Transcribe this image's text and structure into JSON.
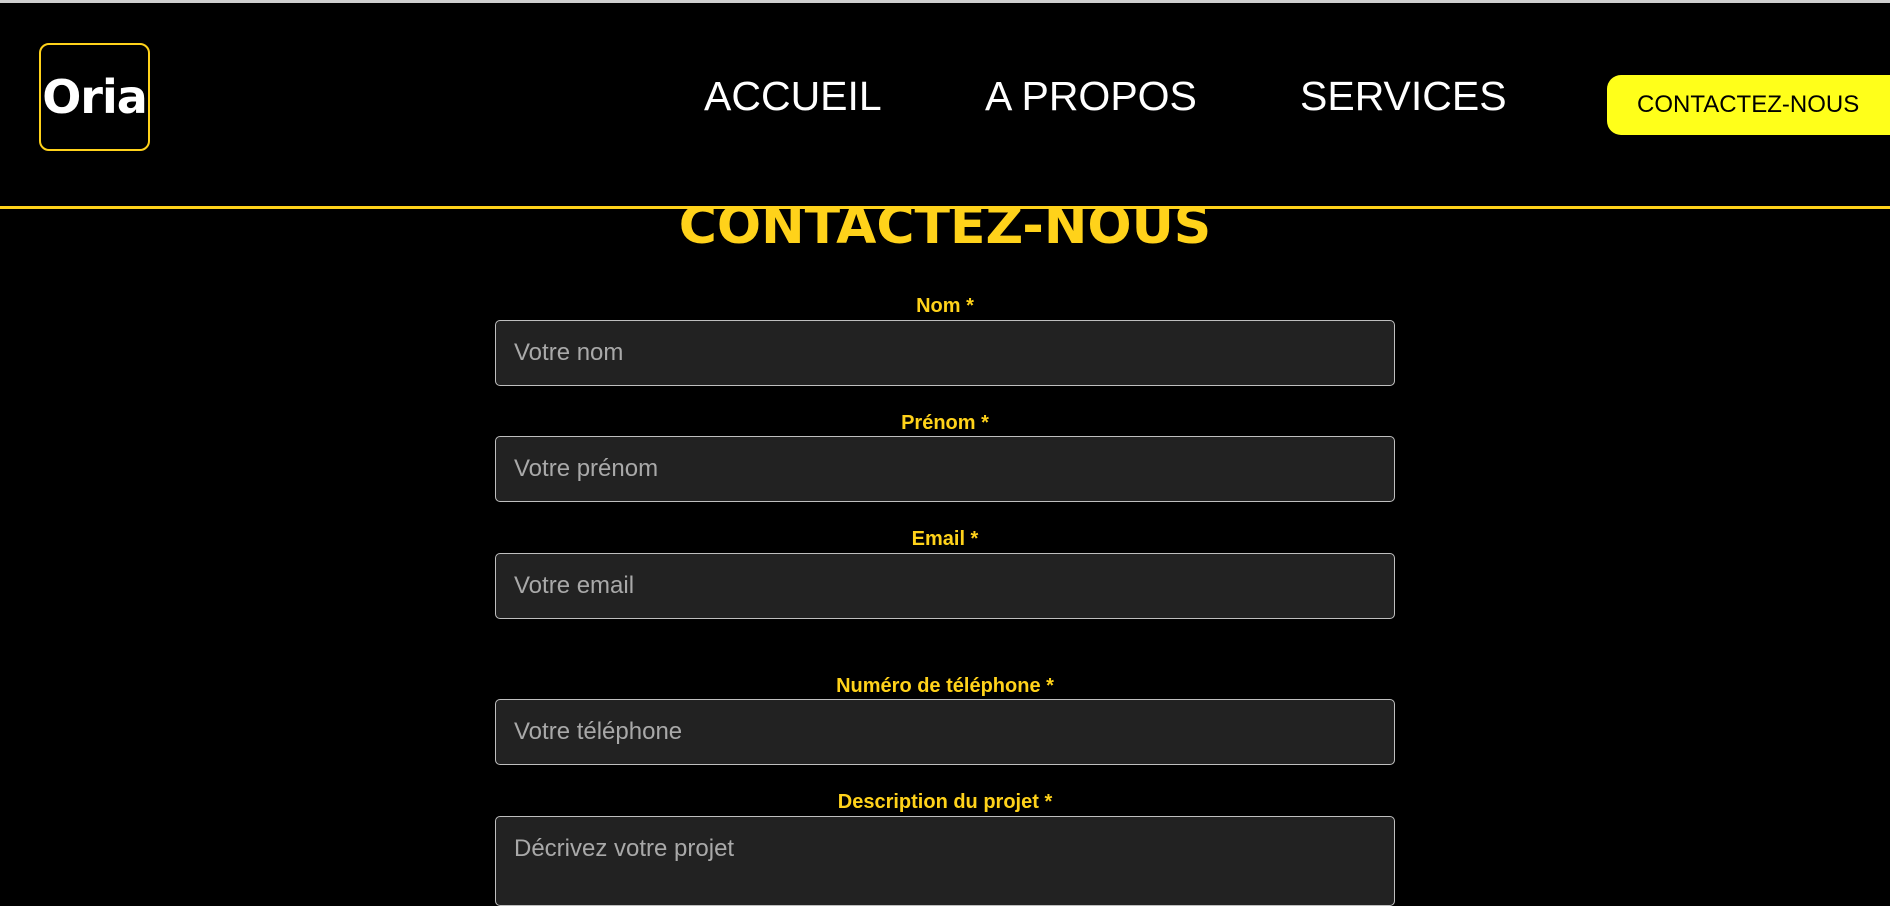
{
  "header": {
    "logo_text": "Oria",
    "nav": [
      {
        "label": "ACCUEIL"
      },
      {
        "label": "A PROPOS"
      },
      {
        "label": "SERVICES"
      }
    ],
    "cta_label": "CONTACTEZ-NOUS"
  },
  "page_title": "CONTACTEZ-NOUS",
  "form": {
    "nom": {
      "label": "Nom *",
      "placeholder": "Votre nom",
      "value": ""
    },
    "prenom": {
      "label": "Prénom *",
      "placeholder": "Votre prénom",
      "value": ""
    },
    "email": {
      "label": "Email *",
      "placeholder": "Votre email",
      "value": ""
    },
    "telephone": {
      "label": "Numéro de téléphone *",
      "placeholder": "Votre téléphone",
      "value": ""
    },
    "description": {
      "label": "Description du projet *",
      "placeholder": "Décrivez votre projet",
      "value": ""
    }
  },
  "colors": {
    "accent": "#ffd21a",
    "cta_background": "#ffff1a",
    "background": "#000000",
    "input_background": "#222222"
  }
}
